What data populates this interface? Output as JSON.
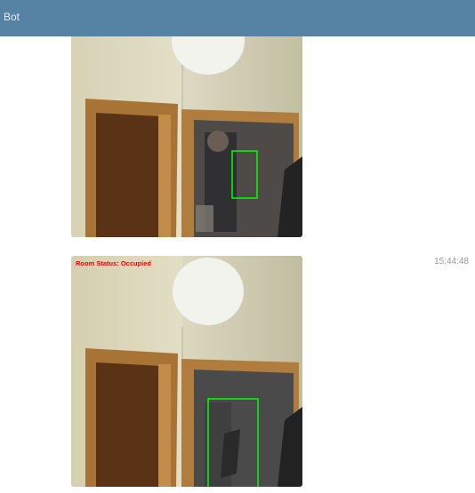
{
  "header": {
    "title": "Bot"
  },
  "messages": [
    {
      "type": "photo",
      "overlay_text": "",
      "timestamp": ""
    },
    {
      "type": "photo",
      "overlay_text": "Room Status: Occupied",
      "timestamp": "15:44:48"
    }
  ],
  "colors": {
    "header_bg": "#5682a3",
    "overlay_text": "#ff0000",
    "detection_box": "#00ff00"
  }
}
